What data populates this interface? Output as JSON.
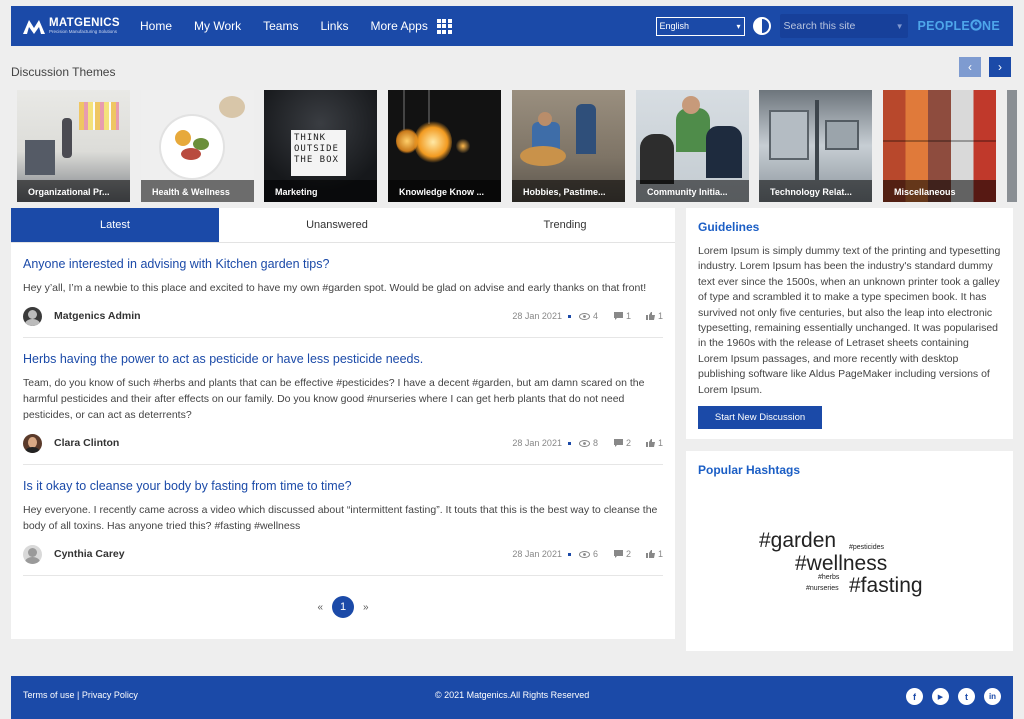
{
  "header": {
    "logo_name": "MATGENICS",
    "logo_tagline": "Precision Manufacturing Solutions",
    "nav": [
      "Home",
      "My Work",
      "Teams",
      "Links",
      "More Apps"
    ],
    "language": "English",
    "search_placeholder": "Search this site",
    "brand_left": "PEOPLE",
    "brand_right": "NE"
  },
  "themes": {
    "title": "Discussion Themes",
    "prev": "‹",
    "next": "›",
    "items": [
      {
        "label": "Organizational Pr..."
      },
      {
        "label": "Health & Wellness"
      },
      {
        "label": "Marketing",
        "photo_text": "THINK OUTSIDE THE BOX"
      },
      {
        "label": "Knowledge Know ..."
      },
      {
        "label": "Hobbies, Pastime..."
      },
      {
        "label": "Community Initia..."
      },
      {
        "label": "Technology Relat..."
      },
      {
        "label": "Miscellaneous"
      }
    ]
  },
  "tabs": [
    "Latest",
    "Unanswered",
    "Trending"
  ],
  "posts": [
    {
      "title": "Anyone interested in advising with Kitchen garden tips?",
      "body": "Hey y’all, I’m a newbie to this place and excited to have my own #garden spot. Would be glad on advise and early thanks on that front!",
      "author": "Matgenics Admin",
      "date": "28 Jan 2021",
      "views": "4",
      "comments": "1",
      "likes": "1"
    },
    {
      "title": "Herbs having the power to act as pesticide or have less pesticide needs.",
      "body": "Team, do you know of such #herbs and plants that can be effective #pesticides? I have a decent #garden, but am damn scared on the harmful pesticides and their after effects on our family. Do you know good #nurseries where I can get herb plants that do not need pesticides, or can act as deterrents?",
      "author": "Clara Clinton",
      "date": "28 Jan 2021",
      "views": "8",
      "comments": "2",
      "likes": "1"
    },
    {
      "title": "Is it okay to cleanse your body by fasting from time to time?",
      "body": "Hey everyone. I recently came across a video which discussed about “intermittent fasting”. It touts that this is the best way to cleanse the body of all toxins. Has anyone tried this? #fasting #wellness",
      "author": "Cynthia Carey",
      "date": "28 Jan 2021",
      "views": "6",
      "comments": "2",
      "likes": "1"
    }
  ],
  "pager": {
    "prev": "«",
    "current": "1",
    "next": "»"
  },
  "guidelines": {
    "title": "Guidelines",
    "text": "Lorem Ipsum is simply dummy text of the printing and typesetting industry. Lorem Ipsum has been the industry's standard dummy text ever since the 1500s, when an unknown printer took a galley of type and scrambled it to make a type specimen book. It has survived not only five centuries, but also the leap into electronic typesetting, remaining essentially unchanged. It was popularised in the 1960s with the release of Letraset sheets containing Lorem Ipsum passages, and more recently with desktop publishing software like Aldus PageMaker including versions of Lorem Ipsum.",
    "button": "Start New Discussion"
  },
  "hashtags": {
    "title": "Popular Hashtags",
    "tags": [
      "#garden",
      "#pesticides",
      "#wellness",
      "#herbs",
      "#nurseries",
      "#fasting"
    ]
  },
  "footer": {
    "terms": "Terms of use",
    "separator": " | ",
    "privacy": "Privacy Policy",
    "copyright": "© 2021 Matgenics.All Rights Reserved",
    "socials": [
      "f",
      "▶",
      "t",
      "in"
    ]
  },
  "colors": {
    "primary": "#1b4aa8",
    "accent": "#4ea6ea",
    "link": "#1b4aa8"
  },
  "icons": [
    "grid-apps-icon",
    "contrast-icon",
    "eye-icon",
    "comment-icon",
    "thumbs-up-icon",
    "facebook-icon",
    "youtube-icon",
    "twitter-icon",
    "linkedin-icon"
  ]
}
